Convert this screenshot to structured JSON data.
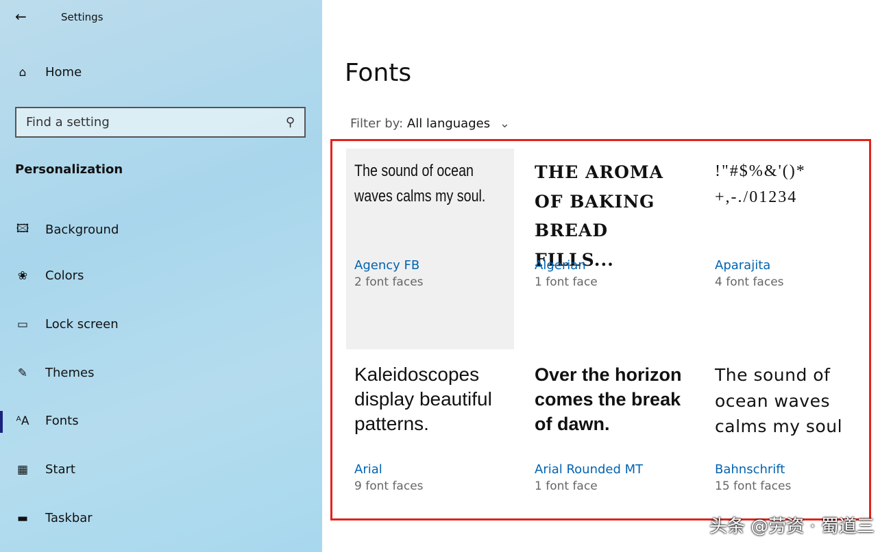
{
  "window": {
    "title": "Settings"
  },
  "sidebar": {
    "home": "Home",
    "search_placeholder": "Find a setting",
    "section": "Personalization",
    "items": [
      {
        "label": "Background",
        "icon": "image-icon"
      },
      {
        "label": "Colors",
        "icon": "palette-icon"
      },
      {
        "label": "Lock screen",
        "icon": "lock-screen-icon"
      },
      {
        "label": "Themes",
        "icon": "themes-icon"
      },
      {
        "label": "Fonts",
        "icon": "fonts-icon",
        "active": true
      },
      {
        "label": "Start",
        "icon": "start-icon"
      },
      {
        "label": "Taskbar",
        "icon": "taskbar-icon"
      }
    ]
  },
  "main": {
    "title": "Fonts",
    "filter_label": "Filter by:",
    "filter_value": "All languages",
    "fonts": [
      {
        "sample": "The sound of ocean waves calms my soul.",
        "name": "Agency FB",
        "faces": "2 font faces"
      },
      {
        "sample": "THE AROMA OF BAKING BREAD FILLS...",
        "name": "Algerian",
        "faces": "1 font face"
      },
      {
        "sample": "!\"#$%&'()* +,-./01234",
        "name": "Aparajita",
        "faces": "4 font faces"
      },
      {
        "sample": "Kaleidoscopes display beautiful patterns.",
        "name": "Arial",
        "faces": "9 font faces"
      },
      {
        "sample": "Over the horizon comes the break of dawn.",
        "name": "Arial Rounded MT",
        "faces": "1 font face"
      },
      {
        "sample": "The sound of ocean waves calms my soul",
        "name": "Bahnschrift",
        "faces": "15 font faces"
      }
    ]
  },
  "watermark": "头条 @劳资 · 蜀道三",
  "colors": {
    "accent": "#0063b1",
    "highlight": "#e0231c"
  }
}
